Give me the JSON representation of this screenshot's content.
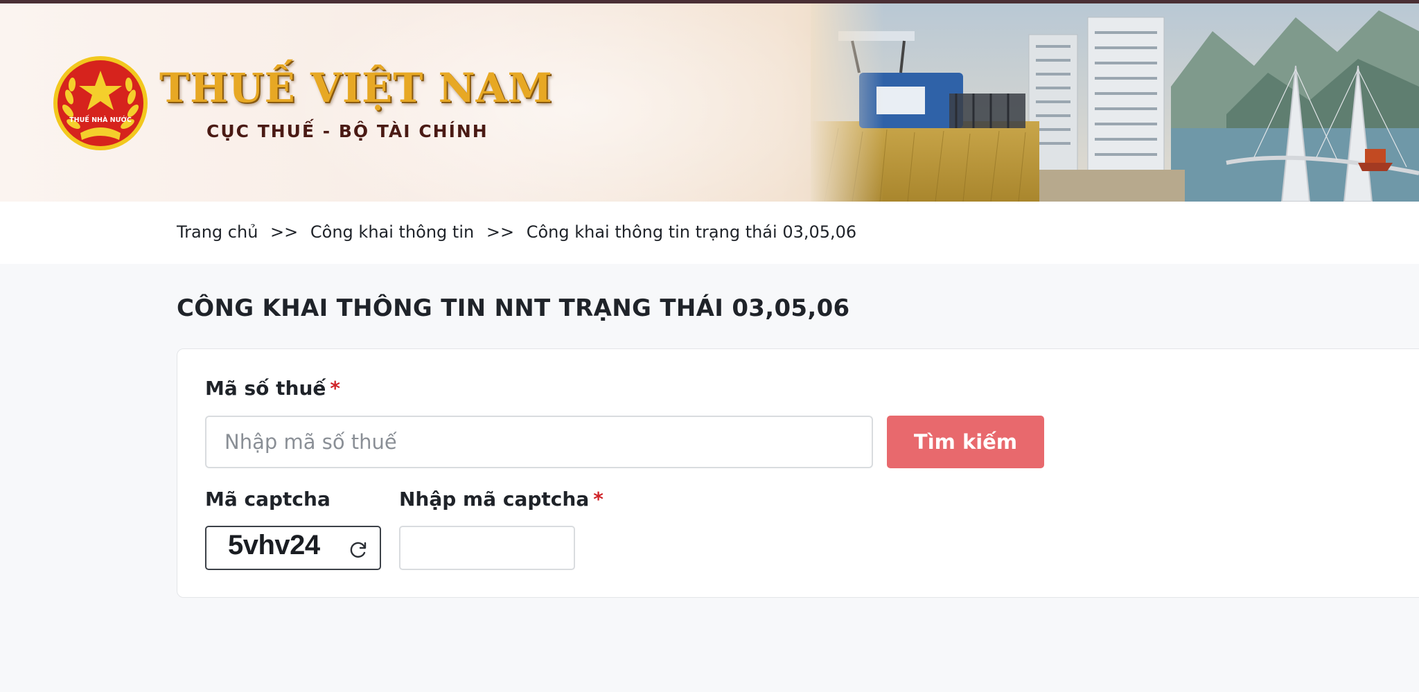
{
  "header": {
    "title": "THUẾ VIỆT NAM",
    "subtitle": "CỤC THUẾ - BỘ TÀI CHÍNH",
    "emblem_text": "THUẾ NHÀ NƯỚC"
  },
  "breadcrumb": {
    "items": [
      "Trang chủ",
      "Công khai thông tin",
      "Công khai thông tin trạng thái 03,05,06"
    ],
    "separator": ">>"
  },
  "page": {
    "title": "CÔNG KHAI THÔNG TIN NNT TRẠNG THÁI 03,05,06"
  },
  "form": {
    "tax_code_label": "Mã số thuế",
    "required_mark": "*",
    "tax_code_placeholder": "Nhập mã số thuế",
    "tax_code_value": "",
    "search_button": "Tìm kiếm",
    "captcha_label": "Mã captcha",
    "captcha_code": "5vhv24",
    "captcha_input_label": "Nhập mã captcha",
    "captcha_input_value": ""
  },
  "colors": {
    "accent": "#e8696d",
    "required": "#d0252a",
    "brand_gold": "#e7a824",
    "brand_red": "#d6231d"
  },
  "icons": {
    "refresh": "refresh-icon",
    "emblem": "national-emblem-icon"
  }
}
